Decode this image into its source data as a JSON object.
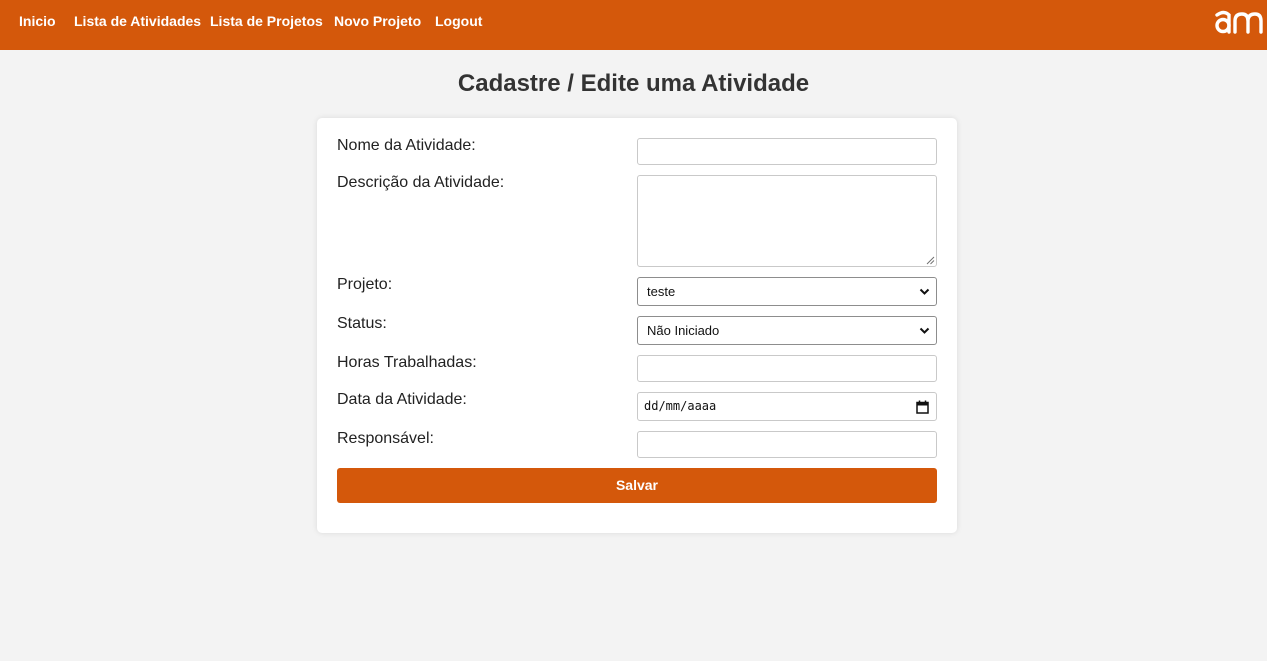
{
  "nav": {
    "links": [
      "Inicio",
      "Lista de Atividades",
      "Lista de Projetos",
      "Novo Projeto",
      "Logout"
    ],
    "logo_text": "am",
    "background": "#d4580b"
  },
  "page": {
    "title": "Cadastre / Edite uma Atividade"
  },
  "form": {
    "nome_label": "Nome da Atividade:",
    "nome_value": "",
    "descricao_label": "Descrição da Atividade:",
    "descricao_value": "",
    "projeto_label": "Projeto:",
    "projeto_selected": "teste",
    "status_label": "Status:",
    "status_selected": "Não Iniciado",
    "horas_label": "Horas Trabalhadas:",
    "horas_value": "",
    "data_label": "Data da Atividade:",
    "data_placeholder": "dd/mm/aaaa",
    "responsavel_label": "Responsável:",
    "responsavel_value": "",
    "submit_label": "Salvar"
  },
  "colors": {
    "accent": "#d4580b",
    "page_background": "#f3f3f3",
    "card_background": "#ffffff"
  },
  "icons": [
    "logo-am",
    "chevron-down-icon",
    "calendar-icon",
    "resize-grip-icon"
  ]
}
